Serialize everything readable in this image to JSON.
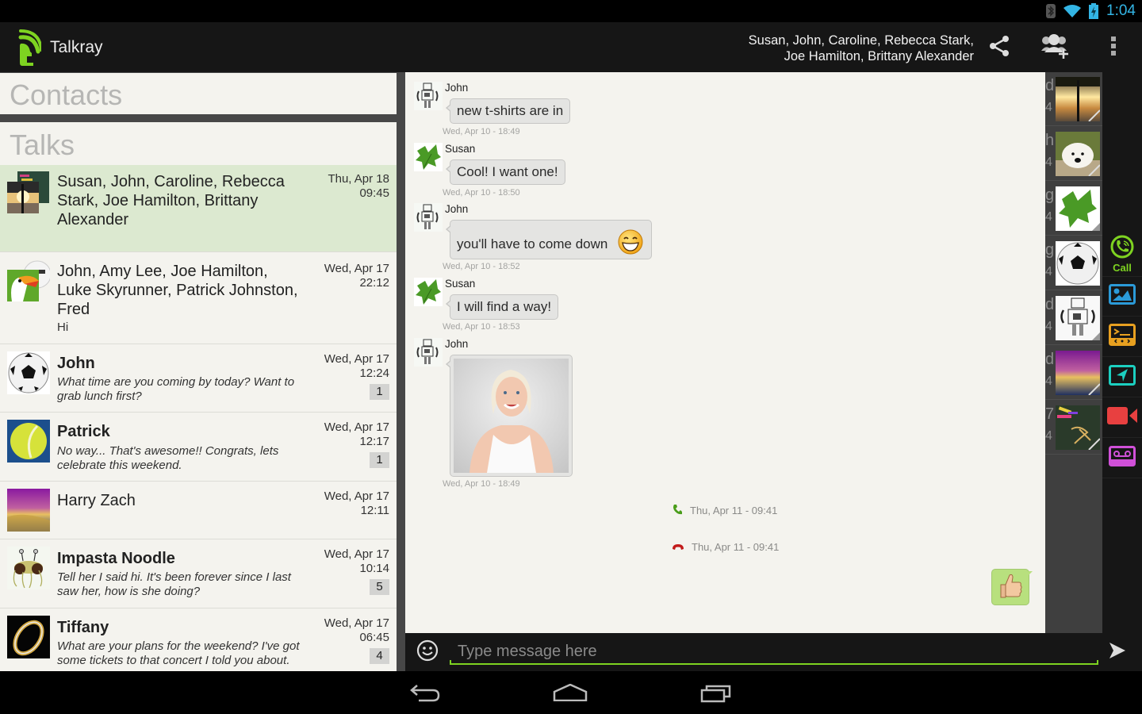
{
  "status_bar": {
    "time": "1:04",
    "icons": [
      "bluetooth-icon",
      "wifi-icon",
      "battery-charging-icon"
    ]
  },
  "action_bar": {
    "app_title": "Talkray",
    "conversation_title_line1": "Susan, John, Caroline, Rebecca Stark,",
    "conversation_title_line2": "Joe Hamilton, Brittany Alexander",
    "buttons": [
      "share-icon",
      "add-participants-icon",
      "overflow-menu-icon"
    ]
  },
  "left_panel": {
    "contacts_title": "Contacts",
    "talks_title": "Talks",
    "talks": [
      {
        "name": "Susan, John, Caroline, Rebecca Stark, Joe Hamilton, Brittany Alexander",
        "preview": "",
        "date": "Thu, Apr 18",
        "time": "09:45",
        "unread": "",
        "selected": true,
        "bold": false,
        "avatar": "group-sunset-avatar"
      },
      {
        "name": "John, Amy Lee, Joe Hamilton, Luke Skyrunner, Patrick Johnston, Fred",
        "preview": "Hi",
        "date": "Wed, Apr 17",
        "time": "22:12",
        "unread": "",
        "selected": false,
        "bold": false,
        "avatar": "group-toucan-avatar"
      },
      {
        "name": "John",
        "preview": "What time are you coming by today? Want to grab lunch first?",
        "date": "Wed, Apr 17",
        "time": "12:24",
        "unread": "1",
        "selected": false,
        "bold": true,
        "avatar": "soccer-ball-avatar"
      },
      {
        "name": "Patrick",
        "preview": "No way... That's awesome!! Congrats, lets celebrate this weekend.",
        "date": "Wed, Apr 17",
        "time": "12:17",
        "unread": "1",
        "selected": false,
        "bold": true,
        "avatar": "tennis-ball-avatar"
      },
      {
        "name": "Harry Zach",
        "preview": "",
        "date": "Wed, Apr 17",
        "time": "12:11",
        "unread": "",
        "selected": false,
        "bold": false,
        "avatar": "city-night-avatar"
      },
      {
        "name": "Impasta Noodle",
        "preview": "Tell her I said hi. It's been forever since I last saw her, how is she doing?",
        "date": "Wed, Apr 17",
        "time": "10:14",
        "unread": "5",
        "selected": false,
        "bold": true,
        "avatar": "noodle-monster-avatar"
      },
      {
        "name": "Tiffany",
        "preview": "What are your plans for the weekend? I've got some tickets to that concert I told you about.",
        "date": "Wed, Apr 17",
        "time": "06:45",
        "unread": "4",
        "selected": false,
        "bold": true,
        "avatar": "ring-avatar"
      }
    ]
  },
  "chat": {
    "messages": [
      {
        "sender": "John",
        "text": "new t-shirts are in",
        "time": "Wed, Apr 10 - 18:49",
        "avatar": "robot-avatar"
      },
      {
        "sender": "Susan",
        "text": "Cool! I want one!",
        "time": "Wed, Apr 10 - 18:50",
        "avatar": "leaf-avatar"
      },
      {
        "sender": "John",
        "text": "you'll have to come down",
        "emoji": "grinning-face",
        "time": "Wed, Apr 10 - 18:52",
        "avatar": "robot-avatar"
      },
      {
        "sender": "Susan",
        "text": "I will find a way!",
        "time": "Wed, Apr 10 - 18:53",
        "avatar": "leaf-avatar"
      },
      {
        "sender": "John",
        "text": "",
        "attachment": "photo-woman-smiling",
        "time": "Wed, Apr 10 - 18:49",
        "avatar": "robot-avatar"
      }
    ],
    "call_events": [
      {
        "type": "incoming-call",
        "time": "Thu, Apr 11 - 09:41",
        "color": "#4a9d1a"
      },
      {
        "type": "ended-call",
        "time": "Thu, Apr 11 - 09:41",
        "color": "#c21b1b"
      }
    ],
    "outgoing_sticker": "thumbs-up-emoji"
  },
  "thumbnail_strip": [
    {
      "letter": "d",
      "num": "4",
      "thumb": "sunset-tree"
    },
    {
      "letter": "hi",
      "num": "4",
      "thumb": "polar-bear"
    },
    {
      "letter": "g",
      "num": "4",
      "thumb": "leaf"
    },
    {
      "letter": "g",
      "num": "4",
      "thumb": "soccer-ball"
    },
    {
      "letter": "d",
      "num": "4",
      "thumb": "robot"
    },
    {
      "letter": "d",
      "num": "4",
      "thumb": "city-night"
    },
    {
      "letter": "7",
      "num": "4",
      "thumb": "chalk"
    }
  ],
  "action_sidebar": {
    "call_label": "Call",
    "buttons": [
      "call-icon",
      "image-icon",
      "terminal-icon",
      "location-icon",
      "video-icon",
      "voice-message-icon"
    ]
  },
  "compose": {
    "placeholder": "Type message here",
    "value": ""
  },
  "colors": {
    "accent_green": "#7ed321",
    "selected_talk_bg": "#dce9d0",
    "panel_bg": "#f4f3ee",
    "status_blue": "#33b5e5"
  }
}
